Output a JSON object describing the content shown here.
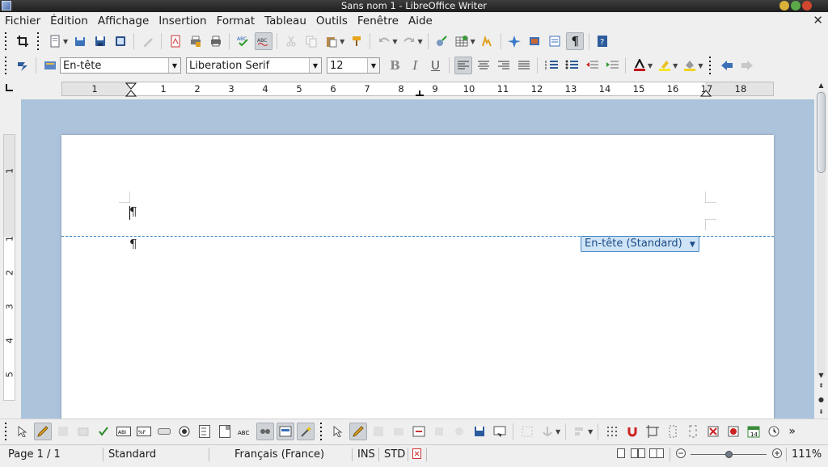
{
  "window": {
    "title": "Sans nom 1 - LibreOffice Writer"
  },
  "menu": [
    "Fichier",
    "Édition",
    "Affichage",
    "Insertion",
    "Format",
    "Tableau",
    "Outils",
    "Fenêtre",
    "Aide"
  ],
  "format_toolbar": {
    "paragraph_style": "En-tête",
    "font_name": "Liberation Serif",
    "font_size": "12"
  },
  "ruler": {
    "horizontal_labels": [
      "1",
      "1",
      "2",
      "3",
      "4",
      "5",
      "6",
      "7",
      "8",
      "9",
      "10",
      "11",
      "12",
      "13",
      "14",
      "15",
      "16",
      "17",
      "18"
    ],
    "vertical_labels": [
      "1",
      "1",
      "2",
      "3",
      "4",
      "5"
    ]
  },
  "document": {
    "header_tag": "En-tête (Standard)",
    "pilcrow": "¶"
  },
  "statusbar": {
    "page": "Page 1 / 1",
    "page_style": "Standard",
    "language": "Français (France)",
    "insert_mode": "INS",
    "selection_mode": "STD",
    "zoom": "111%"
  },
  "icons": {
    "standard_toolbar": [
      "crop-icon",
      "new-document-icon",
      "open-icon",
      "save-icon",
      "export-pdf-icon",
      "edit-file-icon",
      "export-pdf-direct-icon",
      "print-icon",
      "print-preview-icon",
      "spellcheck-icon",
      "autospellcheck-icon",
      "cut-icon",
      "copy-icon",
      "paste-icon",
      "clone-formatting-icon",
      "undo-icon",
      "redo-icon",
      "hyperlink-icon",
      "table-icon",
      "show-draw-functions-icon",
      "navigator-icon",
      "gallery-icon",
      "data-sources-icon",
      "formatting-marks-icon",
      "help-icon"
    ],
    "format_toolbar": [
      "styles-formatting-icon",
      "apply-style-icon",
      "bold-icon",
      "italic-icon",
      "underline-icon",
      "align-left-icon",
      "align-center-icon",
      "align-right-icon",
      "justify-icon",
      "numbering-icon",
      "bullets-icon",
      "decrease-indent-icon",
      "increase-indent-icon",
      "font-color-icon",
      "highlight-icon",
      "background-color-icon",
      "previous-icon",
      "next-icon"
    ]
  }
}
